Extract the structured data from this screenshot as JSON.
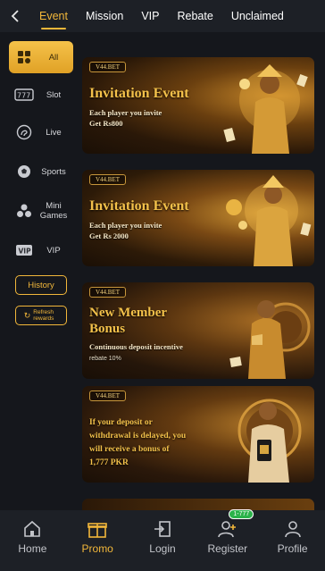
{
  "header": {
    "back_icon": "chevron-left-icon",
    "tabs": [
      {
        "label": "Event",
        "active": true
      },
      {
        "label": "Mission",
        "active": false
      },
      {
        "label": "VIP",
        "active": false
      },
      {
        "label": "Rebate",
        "active": false
      },
      {
        "label": "Unclaimed",
        "active": false
      }
    ]
  },
  "sidebar": {
    "items": [
      {
        "label": "All",
        "icon": "grid-icon",
        "active": true
      },
      {
        "label": "Slot",
        "icon": "slot-machine-icon",
        "active": false
      },
      {
        "label": "Live",
        "icon": "live-dealer-icon",
        "active": false
      },
      {
        "label": "Sports",
        "icon": "soccer-ball-icon",
        "active": false
      },
      {
        "label": "Mini Games",
        "icon": "mini-games-icon",
        "active": false
      },
      {
        "label": "VIP",
        "icon": "vip-badge-icon",
        "active": false
      }
    ],
    "history_label": "History",
    "refresh_label": "Refresh rewards"
  },
  "promos": [
    {
      "brand": "V44.BET",
      "title": "Invitation Event",
      "line1": "Each player you invite",
      "line2": "Get Rs800"
    },
    {
      "brand": "V44.BET",
      "title": "Invitation Event",
      "line1": "Each player you invite",
      "line2": "Get Rs 2000"
    },
    {
      "brand": "V44.BET",
      "title": "New Member",
      "title2": "Bonus",
      "line1": "Continuous deposit incentive",
      "line2": "rebate 10%"
    },
    {
      "brand": "V44.BET",
      "title": "If your deposit or",
      "title2": "withdrawal is delayed, you",
      "title3": "will receive a bonus of",
      "title4": "1,777 PKR"
    }
  ],
  "bottom_nav": [
    {
      "label": "Home",
      "icon": "home-icon",
      "active": false
    },
    {
      "label": "Promo",
      "icon": "gift-icon",
      "active": true
    },
    {
      "label": "Login",
      "icon": "login-icon",
      "active": false
    },
    {
      "label": "Register",
      "icon": "add-user-icon",
      "active": false,
      "badge": "1-777"
    },
    {
      "label": "Profile",
      "icon": "profile-icon",
      "active": false
    }
  ],
  "colors": {
    "accent": "#f2b73a",
    "background": "#15171c",
    "bar": "#1d2026"
  }
}
